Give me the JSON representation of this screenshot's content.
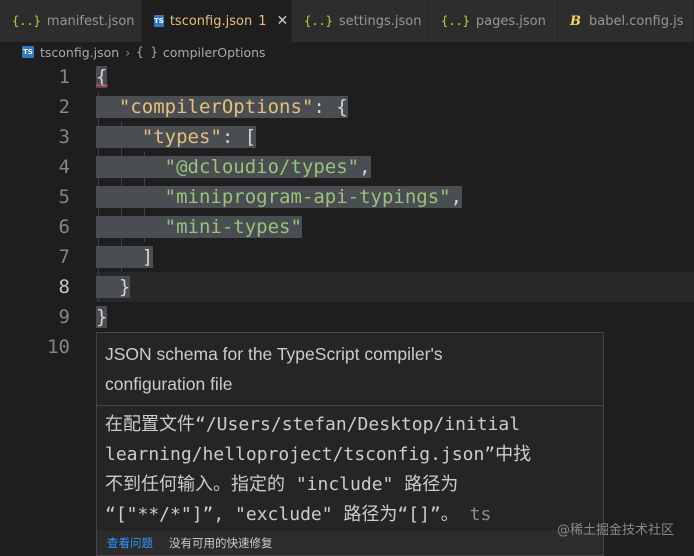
{
  "tabs": [
    {
      "label": "manifest.json",
      "icon": "json-braces-icon"
    },
    {
      "label": "tsconfig.json",
      "icon": "typescript-icon",
      "badge": "1",
      "active": true
    },
    {
      "label": "settings.json",
      "icon": "json-braces-icon"
    },
    {
      "label": "pages.json",
      "icon": "json-braces-icon"
    },
    {
      "label": "babel.config.js",
      "icon": "babel-icon"
    }
  ],
  "tab_icons": {
    "json": "{..}",
    "ts": "TS",
    "babel": "B",
    "close": "✕"
  },
  "breadcrumb": {
    "file": "tsconfig.json",
    "separator": "›",
    "symbol_icon": "{ }",
    "symbol": "compilerOptions"
  },
  "line_numbers": [
    "1",
    "2",
    "3",
    "4",
    "5",
    "6",
    "7",
    "8",
    "9",
    "10"
  ],
  "current_line": "8",
  "code": {
    "l1_brace": "{",
    "l2_key": "\"compilerOptions\"",
    "l2_rest": ": {",
    "l3_key": "\"types\"",
    "l3_rest": ": [",
    "l4_str": "\"@dcloudio/types\"",
    "l4_comma": ",",
    "l5_str": "\"miniprogram-api-typings\"",
    "l5_comma": ",",
    "l6_str": "\"mini-types\"",
    "l7_bracket": "]",
    "l8_brace": "}",
    "l9_brace": "}"
  },
  "hover": {
    "description_1": "JSON schema for the TypeScript compiler's",
    "description_2": "configuration file",
    "msg_1": "在配置文件“/Users/stefan/Desktop/initial",
    "msg_2": "learning/helloproject/tsconfig.json”中找",
    "msg_3": "不到任何输入。指定的 \"include\" 路径为",
    "msg_4": "“[\"**/*\"]”, \"exclude\" 路径为“[]”。",
    "msg_source": "ts",
    "action_view_problem": "查看问题",
    "action_no_quickfix": "没有可用的快速修复"
  },
  "watermark": "@稀土掘金技术社区",
  "colors": {
    "accent_tab": "#e5c07b",
    "link": "#3794ff",
    "selection": "#4a4d51",
    "string_green": "#98c379",
    "key_yellow": "#e5c07b"
  }
}
